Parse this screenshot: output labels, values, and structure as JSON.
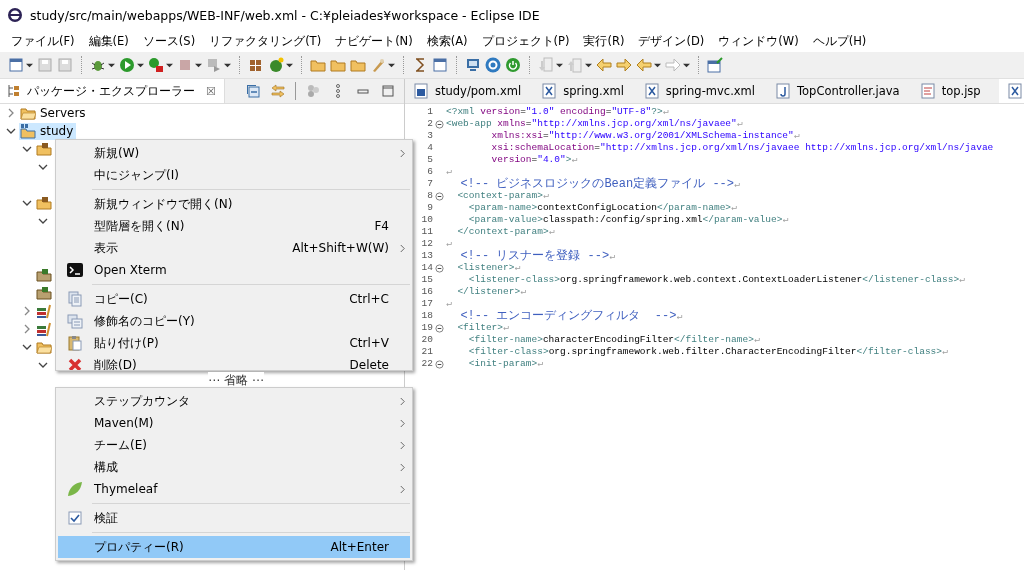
{
  "window": {
    "title": "study/src/main/webapps/WEB-INF/web.xml - C:¥pleiades¥workspace - Eclipse IDE"
  },
  "menu_bar": [
    "ファイル(F)",
    "編集(E)",
    "ソース(S)",
    "リファクタリング(T)",
    "ナビゲート(N)",
    "検索(A)",
    "プロジェクト(P)",
    "実行(R)",
    "デザイン(D)",
    "ウィンドウ(W)",
    "ヘルプ(H)"
  ],
  "package_explorer": {
    "title": "パッケージ・エクスプローラー",
    "close": "☒",
    "tree": [
      {
        "label": "Servers",
        "kind": "folder",
        "expanded": false,
        "selected": false
      },
      {
        "label": "study",
        "kind": "project",
        "expanded": true,
        "selected": true,
        "children": [
          {
            "kind": "source_folder",
            "expanded": true,
            "children": [
              {
                "expanded": true
              }
            ]
          },
          {
            "kind": "source_folder",
            "expanded": true,
            "children": [
              {
                "expanded": true
              }
            ]
          },
          {
            "kind": "package"
          },
          {
            "kind": "package"
          },
          {
            "kind": "library",
            "expanded": false
          },
          {
            "kind": "library",
            "expanded": false
          },
          {
            "kind": "folder",
            "expanded": true,
            "children": [
              {
                "expanded": true
              }
            ]
          }
        ]
      }
    ]
  },
  "editor": {
    "tabs": [
      {
        "label": "study/pom.xml",
        "selected": false
      },
      {
        "label": "spring.xml",
        "selected": false
      },
      {
        "label": "spring-mvc.xml",
        "selected": false
      },
      {
        "label": "TopController.java",
        "selected": false
      },
      {
        "label": "top.jsp",
        "selected": false
      },
      {
        "selected": true
      }
    ],
    "lines": [
      {
        "n": "1",
        "fold": false,
        "parts": [
          {
            "pi": "<?xml "
          },
          {
            "attr": "version"
          },
          {
            "txt": "="
          },
          {
            "val": "\"1.0\" "
          },
          {
            "attr": "encoding"
          },
          {
            "txt": "="
          },
          {
            "val": "\"UTF-8\""
          },
          {
            "pi": "?>"
          },
          {
            "eol": "↵"
          }
        ]
      },
      {
        "n": "2",
        "fold": true,
        "parts": [
          {
            "tag": "<web-app "
          },
          {
            "attr": "xmlns"
          },
          {
            "txt": "="
          },
          {
            "val": "\"http://xmlns.jcp.org/xml/ns/javaee\""
          },
          {
            "eol": "↵"
          }
        ]
      },
      {
        "n": "3",
        "fold": false,
        "parts": [
          {
            "attr": "        xmlns:xsi"
          },
          {
            "txt": "="
          },
          {
            "val": "\"http://www.w3.org/2001/XMLSchema-instance\""
          },
          {
            "eol": "↵"
          }
        ]
      },
      {
        "n": "4",
        "fold": false,
        "parts": [
          {
            "attr": "        xsi:schemaLocation"
          },
          {
            "txt": "="
          },
          {
            "val": "\"http://xmlns.jcp.org/xml/ns/javaee http://xmlns.jcp.org/xml/ns/javae"
          }
        ]
      },
      {
        "n": "5",
        "fold": false,
        "parts": [
          {
            "attr": "        version"
          },
          {
            "txt": "="
          },
          {
            "val": "\"4.0\""
          },
          {
            "tag": ">"
          },
          {
            "eol": "↵"
          }
        ]
      },
      {
        "n": "6",
        "fold": false,
        "parts": [
          {
            "eol": "↵"
          }
        ]
      },
      {
        "n": "7",
        "fold": false,
        "parts": [
          {
            "com": "  <!-- ビジネスロジックのBean定義ファイル -->"
          },
          {
            "eol": "↵"
          }
        ]
      },
      {
        "n": "8",
        "fold": true,
        "parts": [
          {
            "tag": "  <context-param>"
          },
          {
            "eol": "↵"
          }
        ]
      },
      {
        "n": "9",
        "fold": false,
        "parts": [
          {
            "tag": "    <param-name>"
          },
          {
            "txt": "contextConfigLocation"
          },
          {
            "tag": "</param-name>"
          },
          {
            "eol": "↵"
          }
        ]
      },
      {
        "n": "10",
        "fold": false,
        "parts": [
          {
            "tag": "    <param-value>"
          },
          {
            "txt": "classpath:/config/spring.xml"
          },
          {
            "tag": "</param-value>"
          },
          {
            "eol": "↵"
          }
        ]
      },
      {
        "n": "11",
        "fold": false,
        "parts": [
          {
            "tag": "  </context-param>"
          },
          {
            "eol": "↵"
          }
        ]
      },
      {
        "n": "12",
        "fold": false,
        "parts": [
          {
            "eol": "↵"
          }
        ]
      },
      {
        "n": "13",
        "fold": false,
        "parts": [
          {
            "com": "  <!-- リスナーを登録 -->"
          },
          {
            "eol": "↵"
          }
        ]
      },
      {
        "n": "14",
        "fold": true,
        "parts": [
          {
            "tag": "  <listener>"
          },
          {
            "eol": "↵"
          }
        ]
      },
      {
        "n": "15",
        "fold": false,
        "parts": [
          {
            "tag": "    <listener-class>"
          },
          {
            "txt": "org.springframework.web.context.ContextLoaderListener"
          },
          {
            "tag": "</listener-class>"
          },
          {
            "eol": "↵"
          }
        ]
      },
      {
        "n": "16",
        "fold": false,
        "parts": [
          {
            "tag": "  </listener>"
          },
          {
            "eol": "↵"
          }
        ]
      },
      {
        "n": "17",
        "fold": false,
        "parts": [
          {
            "eol": "↵"
          }
        ]
      },
      {
        "n": "18",
        "fold": false,
        "parts": [
          {
            "com": "  <!-- エンコーディングフィルタ  -->"
          },
          {
            "eol": "↵"
          }
        ]
      },
      {
        "n": "19",
        "fold": true,
        "parts": [
          {
            "tag": "  <filter>"
          },
          {
            "eol": "↵"
          }
        ]
      },
      {
        "n": "20",
        "fold": false,
        "parts": [
          {
            "tag": "    <filter-name>"
          },
          {
            "txt": "characterEncodingFilter"
          },
          {
            "tag": "</filter-name>"
          },
          {
            "eol": "↵"
          }
        ]
      },
      {
        "n": "21",
        "fold": false,
        "parts": [
          {
            "tag": "    <filter-class>"
          },
          {
            "txt": "org.springframework.web.filter.CharacterEncodingFilter"
          },
          {
            "tag": "</filter-class>"
          },
          {
            "eol": "↵"
          }
        ]
      },
      {
        "n": "22",
        "fold": true,
        "parts": [
          {
            "tag": "    <init-param>"
          },
          {
            "eol": "↵"
          }
        ]
      }
    ]
  },
  "context_menu": {
    "upper_items": [
      {
        "kind": "item",
        "label": "新規(W)",
        "submenu": true,
        "selected": false
      },
      {
        "kind": "item",
        "label": "中にジャンプ(I)",
        "submenu": false,
        "selected": false
      },
      {
        "kind": "separator"
      },
      {
        "kind": "item",
        "label": "新規ウィンドウで開く(N)",
        "submenu": false,
        "selected": false
      },
      {
        "kind": "item",
        "label": "型階層を開く(N)",
        "shortcut": "F4",
        "submenu": false,
        "selected": false
      },
      {
        "kind": "item",
        "label": "表示",
        "shortcut": "Alt+Shift+W(W)",
        "submenu": true,
        "selected": false
      },
      {
        "kind": "item",
        "label": "Open Xterm",
        "submenu": false,
        "selected": false
      },
      {
        "kind": "separator"
      },
      {
        "kind": "item",
        "label": "コピー(C)",
        "shortcut": "Ctrl+C",
        "submenu": false,
        "selected": false
      },
      {
        "kind": "item",
        "label": "修飾名のコピー(Y)",
        "submenu": false,
        "selected": false
      },
      {
        "kind": "item",
        "label": "貼り付け(P)",
        "shortcut": "Ctrl+V",
        "submenu": false,
        "selected": false
      },
      {
        "kind": "item",
        "label": "削除(D)",
        "shortcut": "Delete",
        "submenu": false,
        "selected": false
      }
    ],
    "omitted_note": "⋯ 省略 ⋯",
    "lower_items": [
      {
        "kind": "item",
        "label": "ステップカウンタ",
        "submenu": true,
        "selected": false
      },
      {
        "kind": "item",
        "label": "Maven(M)",
        "submenu": true,
        "selected": false
      },
      {
        "kind": "item",
        "label": "チーム(E)",
        "submenu": true,
        "selected": false
      },
      {
        "kind": "item",
        "label": "構成",
        "submenu": true,
        "selected": false
      },
      {
        "kind": "item",
        "label": "Thymeleaf",
        "submenu": true,
        "selected": false
      },
      {
        "kind": "separator"
      },
      {
        "kind": "item",
        "label": "検証",
        "submenu": false,
        "selected": false
      },
      {
        "kind": "separator"
      },
      {
        "kind": "item",
        "label": "プロパティー(R)",
        "shortcut": "Alt+Enter",
        "submenu": false,
        "selected": true
      }
    ]
  }
}
